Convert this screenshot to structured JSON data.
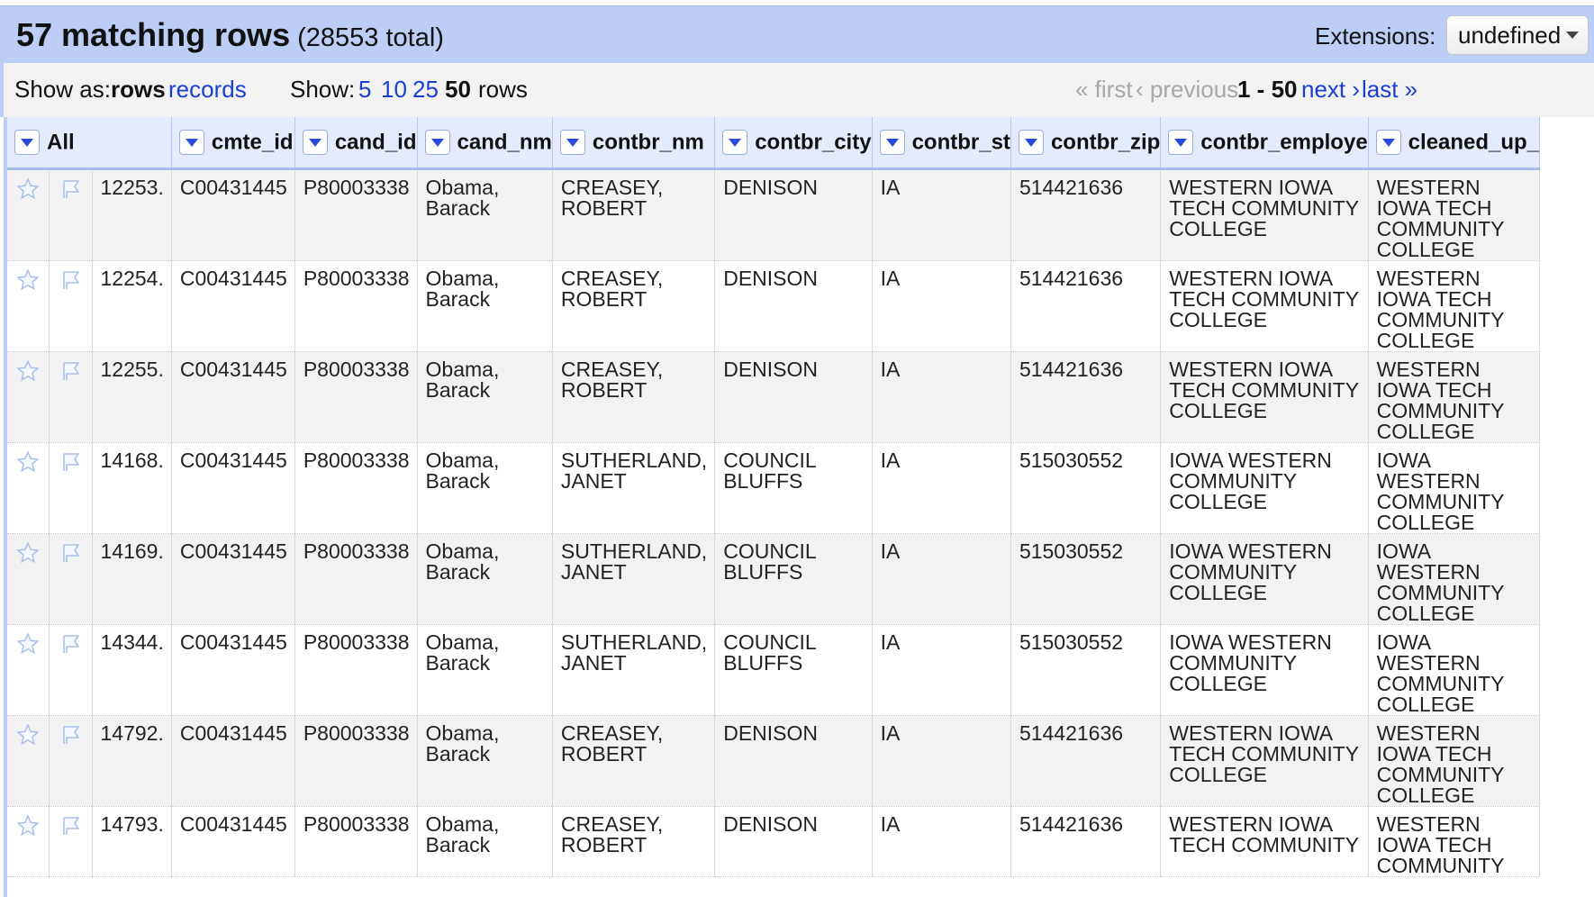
{
  "summary": {
    "matching": "57 matching rows",
    "total": "(28553 total)",
    "extensions_label": "Extensions:",
    "extensions_value": "undefined"
  },
  "controls": {
    "show_as_label": "Show as:",
    "show_as_rows": "rows",
    "show_as_records": "records",
    "show_label": "Show:",
    "page_sizes": [
      "5",
      "10",
      "25",
      "50"
    ],
    "page_size_selected": "50",
    "rows_word": "rows",
    "first": "« first",
    "previous": "‹ previous",
    "range": "1 - 50",
    "next": "next ›",
    "last": "last »"
  },
  "columns": [
    {
      "key": "all",
      "label": "All"
    },
    {
      "key": "cmte_id",
      "label": "cmte_id"
    },
    {
      "key": "cand_id",
      "label": "cand_id"
    },
    {
      "key": "cand_nm",
      "label": "cand_nm"
    },
    {
      "key": "contbr_nm",
      "label": "contbr_nm"
    },
    {
      "key": "contbr_city",
      "label": "contbr_city"
    },
    {
      "key": "contbr_st",
      "label": "contbr_st"
    },
    {
      "key": "contbr_zip",
      "label": "contbr_zip"
    },
    {
      "key": "contbr_employer",
      "label": "contbr_employe"
    },
    {
      "key": "cleaned_up",
      "label": "cleaned_up_"
    }
  ],
  "rows": [
    {
      "num": "12253.",
      "cmte_id": "C00431445",
      "cand_id": "P80003338",
      "cand_nm": "Obama, Barack",
      "contbr_nm": "CREASEY, ROBERT",
      "contbr_city": "DENISON",
      "contbr_st": "IA",
      "contbr_zip": "514421636",
      "employer": "WESTERN IOWA TECH COMMUNITY COLLEGE",
      "cleaned": "WESTERN IOWA TECH COMMUNITY COLLEGE"
    },
    {
      "num": "12254.",
      "cmte_id": "C00431445",
      "cand_id": "P80003338",
      "cand_nm": "Obama, Barack",
      "contbr_nm": "CREASEY, ROBERT",
      "contbr_city": "DENISON",
      "contbr_st": "IA",
      "contbr_zip": "514421636",
      "employer": "WESTERN IOWA TECH COMMUNITY COLLEGE",
      "cleaned": "WESTERN IOWA TECH COMMUNITY COLLEGE"
    },
    {
      "num": "12255.",
      "cmte_id": "C00431445",
      "cand_id": "P80003338",
      "cand_nm": "Obama, Barack",
      "contbr_nm": "CREASEY, ROBERT",
      "contbr_city": "DENISON",
      "contbr_st": "IA",
      "contbr_zip": "514421636",
      "employer": "WESTERN IOWA TECH COMMUNITY COLLEGE",
      "cleaned": "WESTERN IOWA TECH COMMUNITY COLLEGE"
    },
    {
      "num": "14168.",
      "cmte_id": "C00431445",
      "cand_id": "P80003338",
      "cand_nm": "Obama, Barack",
      "contbr_nm": "SUTHERLAND, JANET",
      "contbr_city": "COUNCIL BLUFFS",
      "contbr_st": "IA",
      "contbr_zip": "515030552",
      "employer": "IOWA WESTERN COMMUNITY COLLEGE",
      "cleaned": "IOWA WESTERN COMMUNITY COLLEGE"
    },
    {
      "num": "14169.",
      "cmte_id": "C00431445",
      "cand_id": "P80003338",
      "cand_nm": "Obama, Barack",
      "contbr_nm": "SUTHERLAND, JANET",
      "contbr_city": "COUNCIL BLUFFS",
      "contbr_st": "IA",
      "contbr_zip": "515030552",
      "employer": "IOWA WESTERN COMMUNITY COLLEGE",
      "cleaned": "IOWA WESTERN COMMUNITY COLLEGE"
    },
    {
      "num": "14344.",
      "cmte_id": "C00431445",
      "cand_id": "P80003338",
      "cand_nm": "Obama, Barack",
      "contbr_nm": "SUTHERLAND, JANET",
      "contbr_city": "COUNCIL BLUFFS",
      "contbr_st": "IA",
      "contbr_zip": "515030552",
      "employer": "IOWA WESTERN COMMUNITY COLLEGE",
      "cleaned": "IOWA WESTERN COMMUNITY COLLEGE"
    },
    {
      "num": "14792.",
      "cmte_id": "C00431445",
      "cand_id": "P80003338",
      "cand_nm": "Obama, Barack",
      "contbr_nm": "CREASEY, ROBERT",
      "contbr_city": "DENISON",
      "contbr_st": "IA",
      "contbr_zip": "514421636",
      "employer": "WESTERN IOWA TECH COMMUNITY COLLEGE",
      "cleaned": "WESTERN IOWA TECH COMMUNITY COLLEGE"
    },
    {
      "num": "14793.",
      "cmte_id": "C00431445",
      "cand_id": "P80003338",
      "cand_nm": "Obama, Barack",
      "contbr_nm": "CREASEY, ROBERT",
      "contbr_city": "DENISON",
      "contbr_st": "IA",
      "contbr_zip": "514421636",
      "employer": "WESTERN IOWA TECH COMMUNITY",
      "cleaned": "WESTERN IOWA TECH COMMUNITY"
    }
  ],
  "colors": {
    "header_bg": "#bccdf6",
    "column_header_bg": "#e3ebfd",
    "link": "#1a3fd0",
    "odd_row": "#f2f2f2"
  },
  "icons": {
    "star": "star-icon",
    "flag": "flag-icon",
    "dropdown": "chevron-down-icon"
  }
}
